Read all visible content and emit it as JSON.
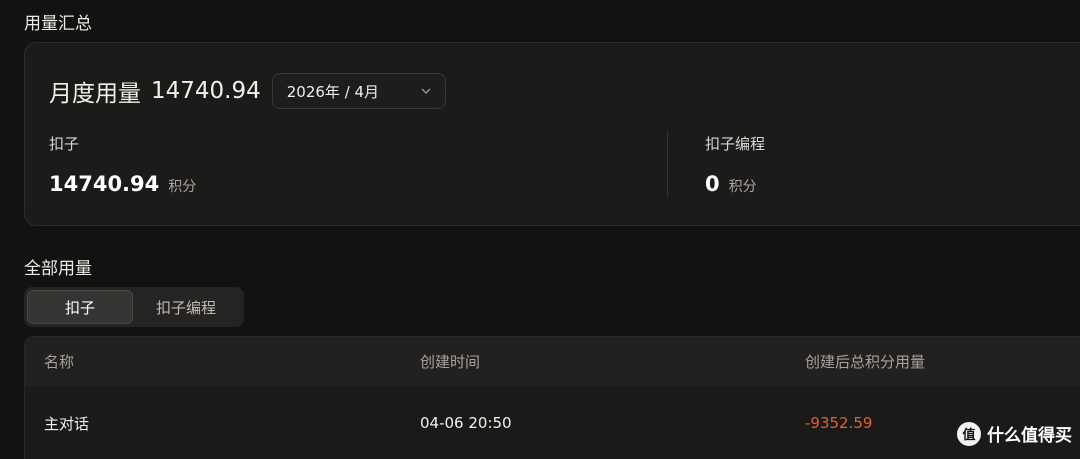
{
  "summary": {
    "title": "用量汇总",
    "month_label": "月度用量",
    "month_total": "14740.94",
    "month_select": "2026年 / 4月",
    "stats": [
      {
        "name": "扣子",
        "value": "14740.94",
        "unit": "积分"
      },
      {
        "name": "扣子编程",
        "value": "0",
        "unit": "积分"
      }
    ]
  },
  "all_usage": {
    "title": "全部用量",
    "tabs": [
      {
        "label": "扣子",
        "active": true
      },
      {
        "label": "扣子编程",
        "active": false
      }
    ],
    "columns": [
      "名称",
      "创建时间",
      "创建后总积分用量"
    ],
    "rows": [
      {
        "name": "主对话",
        "created": "04-06 20:50",
        "usage": "-9352.59"
      }
    ]
  },
  "colors": {
    "background": "#131211",
    "card": "#1d1b1a",
    "negative": "#e0603f"
  },
  "watermark": {
    "text": "什么值得买",
    "icon": "smzdm-logo-icon",
    "logo_glyph": "值"
  }
}
